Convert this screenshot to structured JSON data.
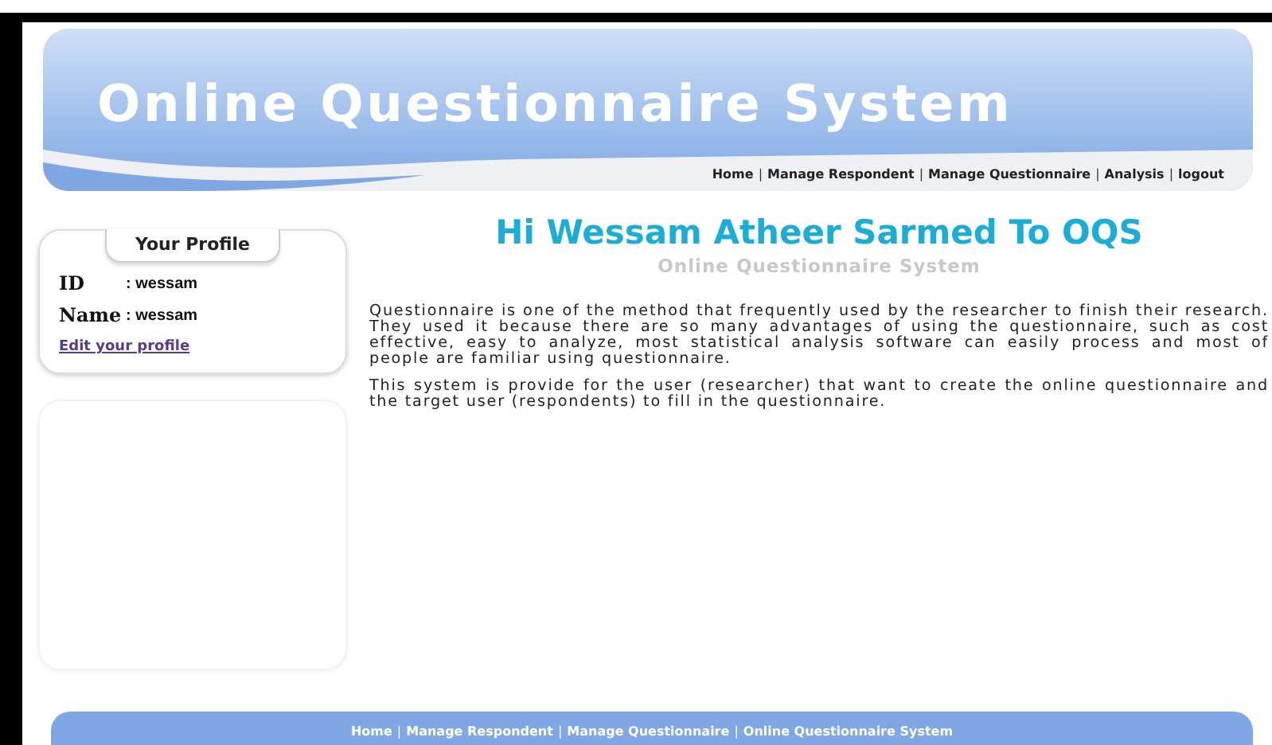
{
  "header": {
    "title": "Online Questionnaire System",
    "nav": [
      {
        "kind": "link",
        "label": "Home"
      },
      {
        "kind": "separator",
        "label": "|"
      },
      {
        "kind": "link",
        "label": "Manage Respondent"
      },
      {
        "kind": "separator",
        "label": "|"
      },
      {
        "kind": "link",
        "label": "Manage Questionnaire"
      },
      {
        "kind": "separator",
        "label": "|"
      },
      {
        "kind": "link",
        "label": "Analysis"
      },
      {
        "kind": "separator",
        "label": "|"
      },
      {
        "kind": "link",
        "label": "logout"
      }
    ]
  },
  "profile": {
    "title": "Your Profile",
    "fields": [
      {
        "label": "ID",
        "value": ": wessam"
      },
      {
        "label": "Name",
        "value": ": wessam"
      }
    ],
    "link": "Edit your profile"
  },
  "main": {
    "heading": "Hi Wessam Atheer Sarmed To OQS",
    "subtitle": "Online Questionnaire System",
    "paragraphs": [
      "Questionnaire is one of the method that frequently used by the researcher to finish their research. They used it because there are so many advantages of using the questionnaire, such as cost effective, easy to analyze, most statistical analysis software can easily process and most of people are familiar using questionnaire.",
      "This system is provide for the user (researcher) that want to create the online questionnaire and the target user (respondents) to fill in the questionnaire."
    ]
  },
  "footer": {
    "links": [
      {
        "kind": "link",
        "label": "Home"
      },
      {
        "kind": "separator",
        "label": "|"
      },
      {
        "kind": "link",
        "label": "Manage Respondent"
      },
      {
        "kind": "separator",
        "label": "|"
      },
      {
        "kind": "link",
        "label": "Manage Questionnaire"
      },
      {
        "kind": "separator",
        "label": "|"
      },
      {
        "kind": "link",
        "label": "Online Questionnaire System"
      }
    ]
  }
}
